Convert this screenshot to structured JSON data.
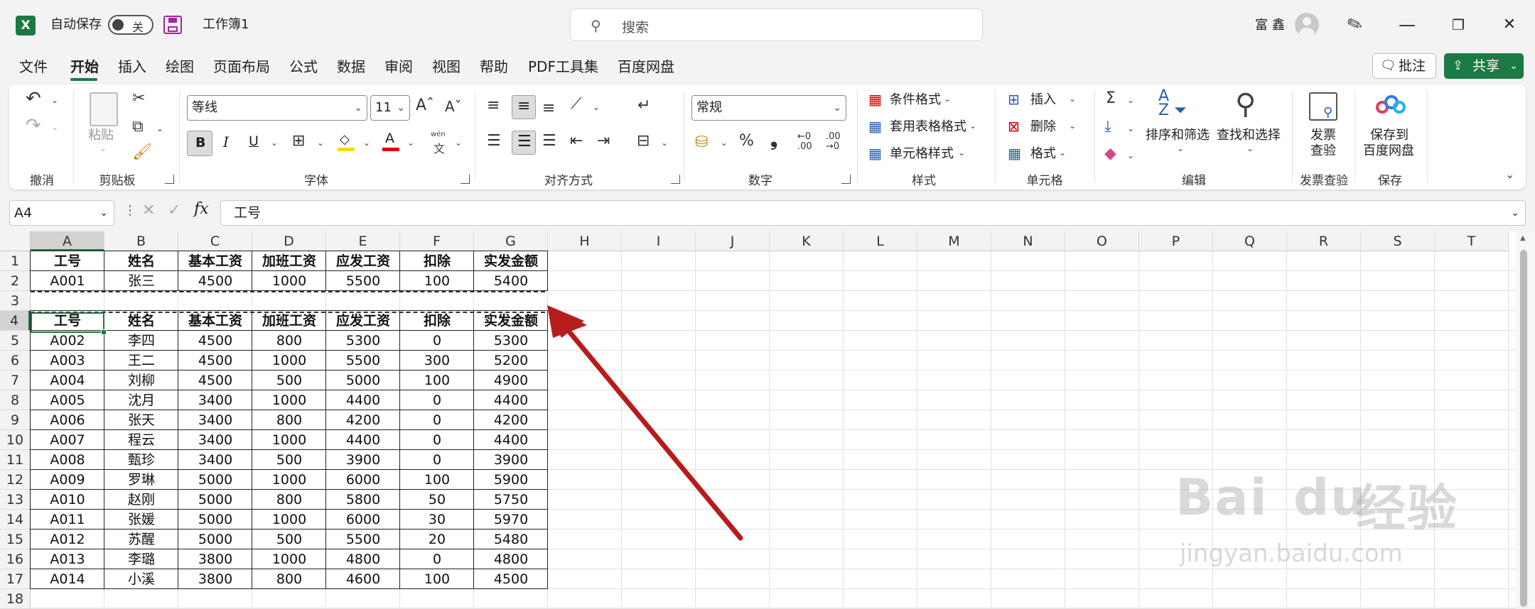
{
  "titlebar": {
    "autosave_label": "自动保存",
    "autosave_state": "关",
    "workbook_name": "工作簿1",
    "search_placeholder": "搜索",
    "user_name": "富鑫",
    "minimize": "—",
    "restore": "❐",
    "close": "✕"
  },
  "menu": {
    "tabs": [
      "文件",
      "开始",
      "插入",
      "绘图",
      "页面布局",
      "公式",
      "数据",
      "审阅",
      "视图",
      "帮助",
      "PDF工具集",
      "百度网盘"
    ],
    "active": "开始",
    "comment_button": "批注",
    "share_button": "共享"
  },
  "ribbon": {
    "groups": {
      "undo": "撤消",
      "clipboard": "剪贴板",
      "font": "字体",
      "align": "对齐方式",
      "number": "数字",
      "styles": "样式",
      "cells": "单元格",
      "edit": "编辑",
      "invoice": "发票查验",
      "save": "保存"
    },
    "paste_label": "粘贴",
    "font_name": "等线",
    "font_size": "11",
    "number_format": "常规",
    "cond_format": "条件格式",
    "table_format": "套用表格格式",
    "cell_style": "单元格样式",
    "insert": "插入",
    "delete": "删除",
    "format": "格式",
    "sort_filter": "排序和筛选",
    "find_select": "查找和选择",
    "invoice_btn_1": "发票",
    "invoice_btn_2": "查验",
    "save_btn_1": "保存到",
    "save_btn_2": "百度网盘",
    "bold": "B",
    "italic": "I",
    "underline": "U",
    "percent": "%",
    "comma": "❟",
    "sigma": "Σ",
    "wen": "wén",
    "wen_char": "文"
  },
  "formula_bar": {
    "name_box": "A4",
    "formula": "工号",
    "fx": "fx"
  },
  "sheet": {
    "columns": [
      "A",
      "B",
      "C",
      "D",
      "E",
      "F",
      "G",
      "H",
      "I",
      "J",
      "K",
      "L",
      "M",
      "N",
      "O",
      "P",
      "Q",
      "R",
      "S",
      "T"
    ],
    "rows": [
      "1",
      "2",
      "3",
      "4",
      "5",
      "6",
      "7",
      "8",
      "9",
      "10",
      "11",
      "12",
      "13",
      "14",
      "15",
      "16",
      "17",
      "18"
    ],
    "header": [
      "工号",
      "姓名",
      "基本工资",
      "加班工资",
      "应发工资",
      "扣除",
      "实发金额"
    ],
    "row2": [
      "A001",
      "张三",
      "4500",
      "1000",
      "5500",
      "100",
      "5400"
    ],
    "data": [
      [
        "A002",
        "李四",
        "4500",
        "800",
        "5300",
        "0",
        "5300"
      ],
      [
        "A003",
        "王二",
        "4500",
        "1000",
        "5500",
        "300",
        "5200"
      ],
      [
        "A004",
        "刘柳",
        "4500",
        "500",
        "5000",
        "100",
        "4900"
      ],
      [
        "A005",
        "沈月",
        "3400",
        "1000",
        "4400",
        "0",
        "4400"
      ],
      [
        "A006",
        "张天",
        "3400",
        "800",
        "4200",
        "0",
        "4200"
      ],
      [
        "A007",
        "程云",
        "3400",
        "1000",
        "4400",
        "0",
        "4400"
      ],
      [
        "A008",
        "甄珍",
        "3400",
        "500",
        "3900",
        "0",
        "3900"
      ],
      [
        "A009",
        "罗琳",
        "5000",
        "1000",
        "6000",
        "100",
        "5900"
      ],
      [
        "A010",
        "赵刚",
        "5000",
        "800",
        "5800",
        "50",
        "5750"
      ],
      [
        "A011",
        "张媛",
        "5000",
        "1000",
        "6000",
        "30",
        "5970"
      ],
      [
        "A012",
        "苏醒",
        "5000",
        "500",
        "5500",
        "20",
        "5480"
      ],
      [
        "A013",
        "李璐",
        "3800",
        "1000",
        "4800",
        "0",
        "4800"
      ],
      [
        "A014",
        "小溪",
        "3800",
        "800",
        "4600",
        "100",
        "4500"
      ]
    ],
    "selected_cell": "A4"
  },
  "watermark": {
    "brand": "Bai",
    "brand2": "du",
    "cn": "经验",
    "url": "jingyan.baidu.com"
  },
  "colors": {
    "accent": "#1b7a43",
    "arrow": "#b71c1c"
  }
}
